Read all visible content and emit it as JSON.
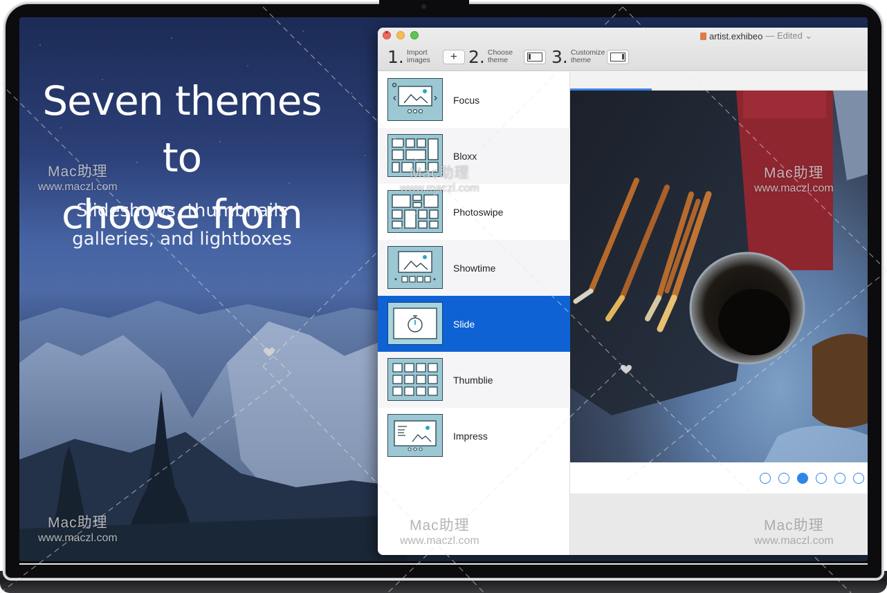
{
  "hero": {
    "title": "Seven themes to\nchoose from",
    "subtitle": "Slideshows, thumbnails\ngalleries, and lightboxes"
  },
  "window": {
    "doc_name": "artist.exhibeo",
    "doc_status": "— Edited ⌄"
  },
  "steps": [
    {
      "number": "1.",
      "label": "Import\nimages",
      "icon": "plus-icon",
      "glyph": "+"
    },
    {
      "number": "2.",
      "label": "Choose\ntheme",
      "icon": "left-panel-icon"
    },
    {
      "number": "3.",
      "label": "Customize\ntheme",
      "icon": "right-panel-icon"
    }
  ],
  "themes": [
    {
      "name": "Focus",
      "selected": false
    },
    {
      "name": "Bloxx",
      "selected": false
    },
    {
      "name": "Photoswipe",
      "selected": false
    },
    {
      "name": "Showtime",
      "selected": false
    },
    {
      "name": "Slide",
      "selected": true
    },
    {
      "name": "Thumblie",
      "selected": false
    },
    {
      "name": "Impress",
      "selected": false
    }
  ],
  "preview": {
    "dot_count": 6,
    "active_dot": 3
  },
  "watermark": {
    "line1": "Mac助理",
    "line2": "www.maczl.com"
  },
  "colors": {
    "selected": "#0f62d3",
    "thumb": "#9cc8d4",
    "dot": "#2f86e6"
  }
}
